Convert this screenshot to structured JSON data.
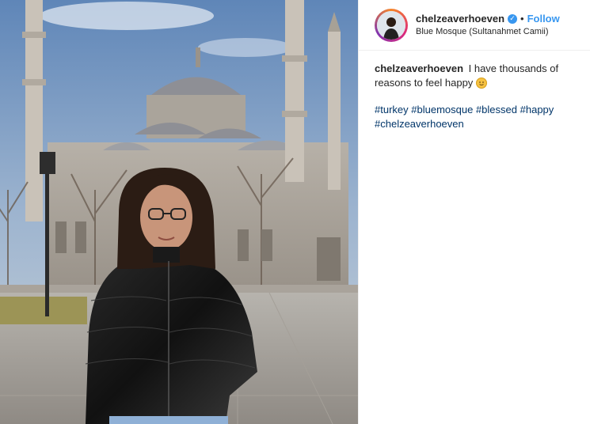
{
  "post": {
    "username": "chelzeaverhoeven",
    "follow_label": "Follow",
    "separator": "•",
    "location": "Blue Mosque (Sultanahmet Camii)",
    "caption_text": " I have thousands of reasons to feel happy ",
    "emoji": "smiling-face-emoji",
    "hashtags": [
      "#turkey",
      "#bluemosque",
      "#blessed",
      "#happy",
      "#chelzeaverhoeven"
    ],
    "verified_icon": "verified-badge-icon",
    "colors": {
      "link": "#3897f0",
      "hashtag": "#003569",
      "text": "#262626"
    }
  },
  "photo": {
    "subject": "woman in black puffer jacket in front of Blue Mosque"
  }
}
